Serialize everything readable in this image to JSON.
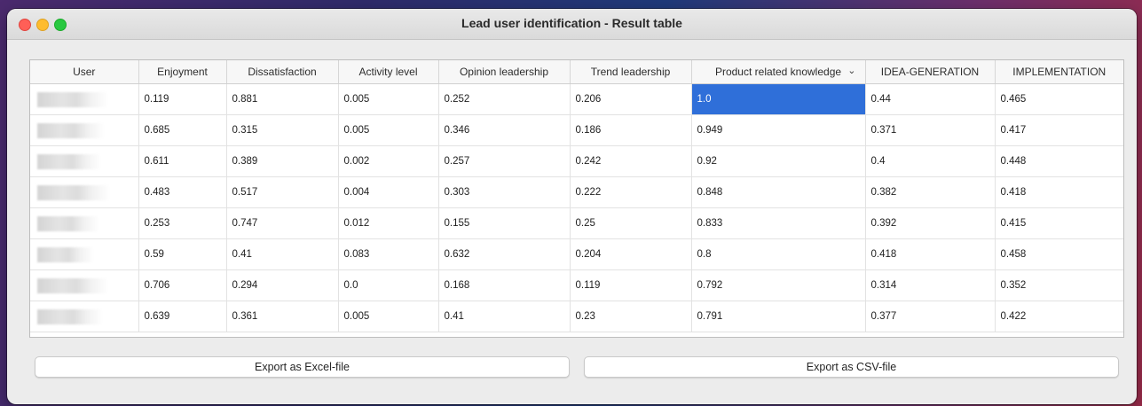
{
  "window": {
    "title": "Lead user identification - Result table"
  },
  "table": {
    "columns": [
      "User",
      "Enjoyment",
      "Dissatisfaction",
      "Activity level",
      "Opinion leadership",
      "Trend leadership",
      "Product related knowledge",
      "IDEA-GENERATION",
      "IMPLEMENTATION"
    ],
    "sorted_column_indicator": "chevron-down-icon",
    "rows": [
      [
        "0.119",
        "0.881",
        "0.005",
        "0.252",
        "0.206",
        "1.0",
        "0.44",
        "0.465"
      ],
      [
        "0.685",
        "0.315",
        "0.005",
        "0.346",
        "0.186",
        "0.949",
        "0.371",
        "0.417"
      ],
      [
        "0.611",
        "0.389",
        "0.002",
        "0.257",
        "0.242",
        "0.92",
        "0.4",
        "0.448"
      ],
      [
        "0.483",
        "0.517",
        "0.004",
        "0.303",
        "0.222",
        "0.848",
        "0.382",
        "0.418"
      ],
      [
        "0.253",
        "0.747",
        "0.012",
        "0.155",
        "0.25",
        "0.833",
        "0.392",
        "0.415"
      ],
      [
        "0.59",
        "0.41",
        "0.083",
        "0.632",
        "0.204",
        "0.8",
        "0.418",
        "0.458"
      ],
      [
        "0.706",
        "0.294",
        "0.0",
        "0.168",
        "0.119",
        "0.792",
        "0.314",
        "0.352"
      ],
      [
        "0.639",
        "0.361",
        "0.005",
        "0.41",
        "0.23",
        "0.791",
        "0.377",
        "0.422"
      ]
    ],
    "selected_cell": {
      "row": 0,
      "column": 6
    }
  },
  "buttons": {
    "export_excel": "Export as Excel-file",
    "export_csv": "Export as CSV-file"
  },
  "colors": {
    "selection": "#2f6fd9",
    "close": "#ff5f57",
    "minimize": "#febc2e",
    "maximize": "#28c840"
  }
}
